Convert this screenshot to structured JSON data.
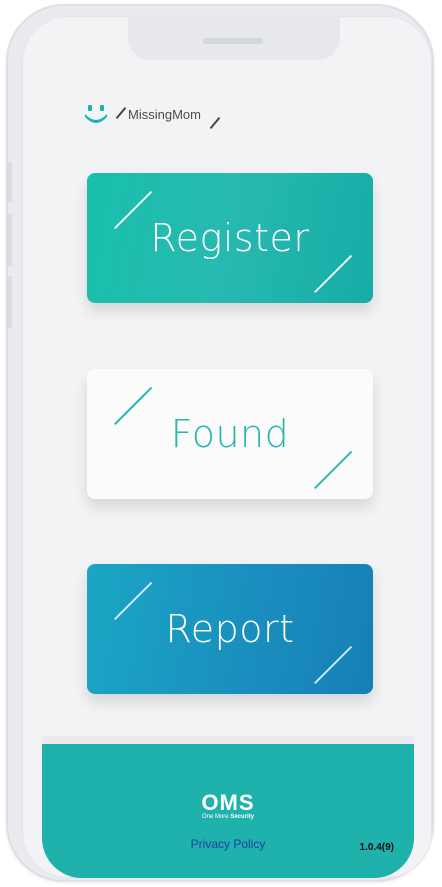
{
  "app": {
    "name": "MissingMom"
  },
  "buttons": {
    "register_label": "Register",
    "found_label": "Found",
    "report_label": "Report"
  },
  "footer": {
    "brand": "OMS",
    "tagline_prefix": "One More ",
    "tagline_bold": "Security",
    "privacy_label": "Privacy Policy",
    "version": "1.0.4(9)"
  },
  "colors": {
    "register": "#1fbaad",
    "found_text": "#27b6ad",
    "report": "#1a93c1",
    "footer": "#1fb2ac"
  }
}
